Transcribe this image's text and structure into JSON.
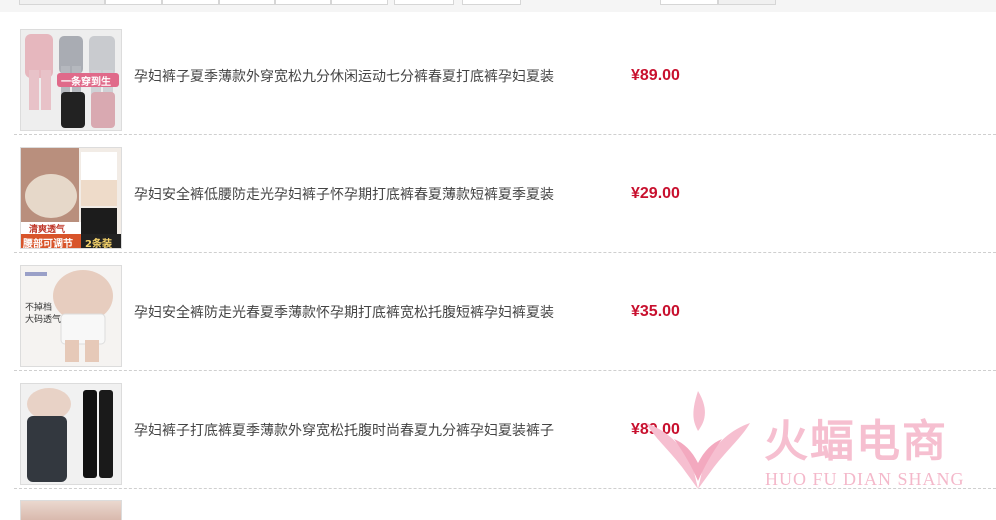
{
  "products": [
    {
      "title": "孕妇裤子夏季薄款外穿宽松九分休闲运动七分裤春夏打底裤孕妇夏装",
      "price": "¥89.00",
      "thumb_text": "一条穿到生"
    },
    {
      "title": "孕妇安全裤低腰防走光孕妇裤子怀孕期打底裤春夏薄款短裤夏季夏装",
      "price": "¥29.00",
      "thumb_text": "腰部可调节",
      "thumb_text_2": "2条装",
      "thumb_text_3": "清爽透气"
    },
    {
      "title": "孕妇安全裤防走光春夏季薄款怀孕期打底裤宽松托腹短裤孕妇裤夏装",
      "price": "¥35.00",
      "thumb_text": "不掉档",
      "thumb_text_2": "大码透气"
    },
    {
      "title": "孕妇裤子打底裤夏季薄款外穿宽松托腹时尚春夏九分裤孕妇夏装裤子",
      "price": "¥89.00"
    }
  ],
  "watermark": {
    "name": "火蝠电商",
    "subtitle": "HUO FU DIAN SHANG",
    "color": "#f6bfd0"
  },
  "colors": {
    "price": "#c8102e",
    "divider": "#cfcfcf"
  }
}
